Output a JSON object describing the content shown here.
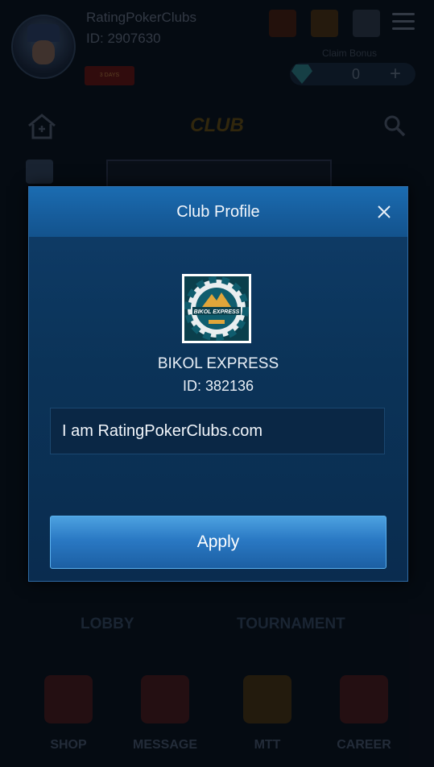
{
  "header": {
    "user_name": "RatingPokerClubs",
    "user_id": "ID: 2907630",
    "vip_badge": "3 DAYS",
    "bonus_label": "Claim Bonus",
    "bonus_value": "0"
  },
  "page": {
    "title": "CLUB"
  },
  "lobby_label": "LOBBY",
  "tournament_label": "TOURNAMENT",
  "bottom_nav": {
    "shop": "SHOP",
    "message": "MESSAGE",
    "mtt": "MTT",
    "career": "CAREER"
  },
  "dialog": {
    "title": "Club Profile",
    "club_logo_text": "BIKOL EXPRESS",
    "club_name": "BIKOL EXPRESS",
    "club_id": "ID: 382136",
    "message": "I am RatingPokerClubs.com",
    "apply_label": "Apply"
  },
  "colors": {
    "dialog_bg": "#0b3358",
    "header_bg": "#165c9b",
    "button": "#2a79c4",
    "logo_teal": "#0f5d6e",
    "logo_gold": "#e0a53a"
  },
  "icons": {
    "close": "close-icon",
    "home": "home-icon",
    "search": "search-icon",
    "menu": "menu-icon"
  }
}
